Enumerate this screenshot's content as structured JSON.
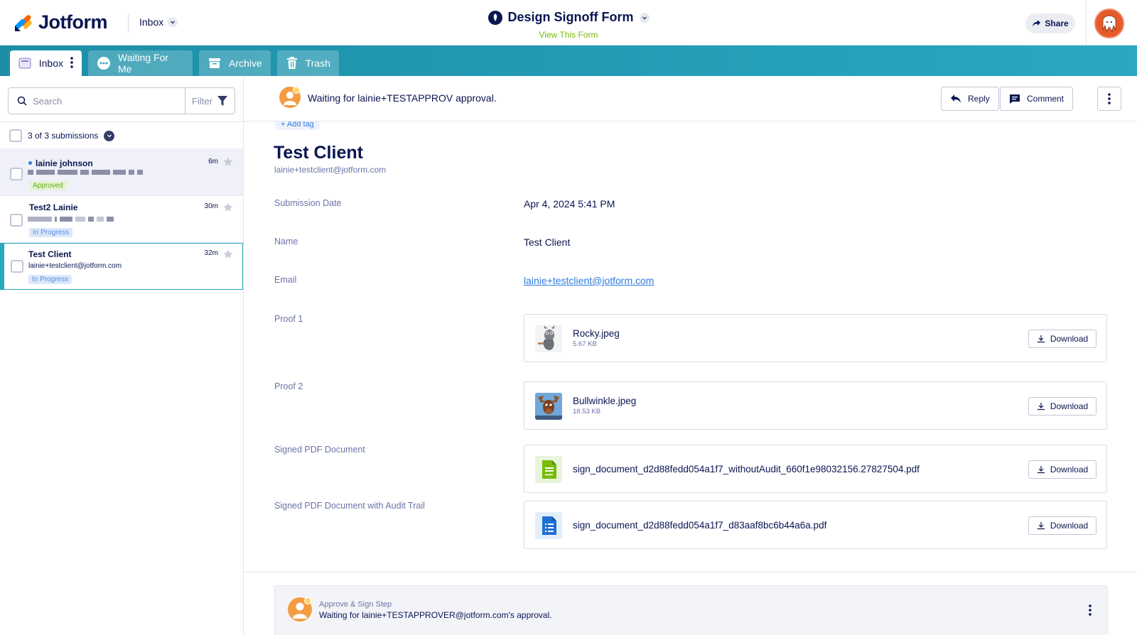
{
  "header": {
    "logo_text": "Jotform",
    "inbox_label": "Inbox",
    "form_title": "Design Signoff Form",
    "form_link": "View This Form",
    "share_label": "Share"
  },
  "tabs": [
    {
      "label": "Inbox"
    },
    {
      "label": "Waiting For Me"
    },
    {
      "label": "Archive"
    },
    {
      "label": "Trash"
    }
  ],
  "sidebar": {
    "search_placeholder": "Search",
    "filter_label": "Filter",
    "count_label": "3 of 3 submissions",
    "items": [
      {
        "name": "lainie johnson",
        "time": "6m",
        "status": "Approved",
        "unread": true
      },
      {
        "name": "Test2 Lainie",
        "time": "30m",
        "status": "In Progress"
      },
      {
        "name": "Test Client",
        "time": "32m",
        "email": "lainie+testclient@jotform.com",
        "status": "In Progress"
      }
    ]
  },
  "actionbar": {
    "waiting_text": "Waiting for lainie+TESTAPPROV approval.",
    "reply_label": "Reply",
    "comment_label": "Comment"
  },
  "submission": {
    "add_tag": "+ Add tag",
    "client_name": "Test Client",
    "client_email": "lainie+testclient@jotform.com",
    "fields": {
      "date_label": "Submission Date",
      "date_value": "Apr 4, 2024 5:41 PM",
      "name_label": "Name",
      "name_value": "Test Client",
      "email_label": "Email",
      "email_value": "lainie+testclient@jotform.com",
      "proof1_label": "Proof 1",
      "proof2_label": "Proof 2",
      "signed_label": "Signed PDF Document",
      "audit_label": "Signed PDF Document with Audit Trail"
    },
    "files": {
      "proof1": {
        "name": "Rocky.jpeg",
        "size": "5.67 KB"
      },
      "proof2": {
        "name": "Bullwinkle.jpeg",
        "size": "18.53 KB"
      },
      "signed": {
        "name": "sign_document_d2d88fedd054a1f7_withoutAudit_660f1e98032156.27827504.pdf"
      },
      "audit": {
        "name": "sign_document_d2d88fedd054a1f7_d83aaf8bc6b44a6a.pdf"
      }
    },
    "download_label": "Download"
  },
  "step": {
    "title": "Approve & Sign Step",
    "text": "Waiting for lainie+TESTAPPROVER@jotform.com's approval."
  },
  "colors": {
    "navy": "#0a1551",
    "teal": "#1c8fa7",
    "link": "#2f7ce0",
    "approved": "#6cab2b",
    "progress": "#5a8de0",
    "avatar_orange": "#f39c44"
  }
}
